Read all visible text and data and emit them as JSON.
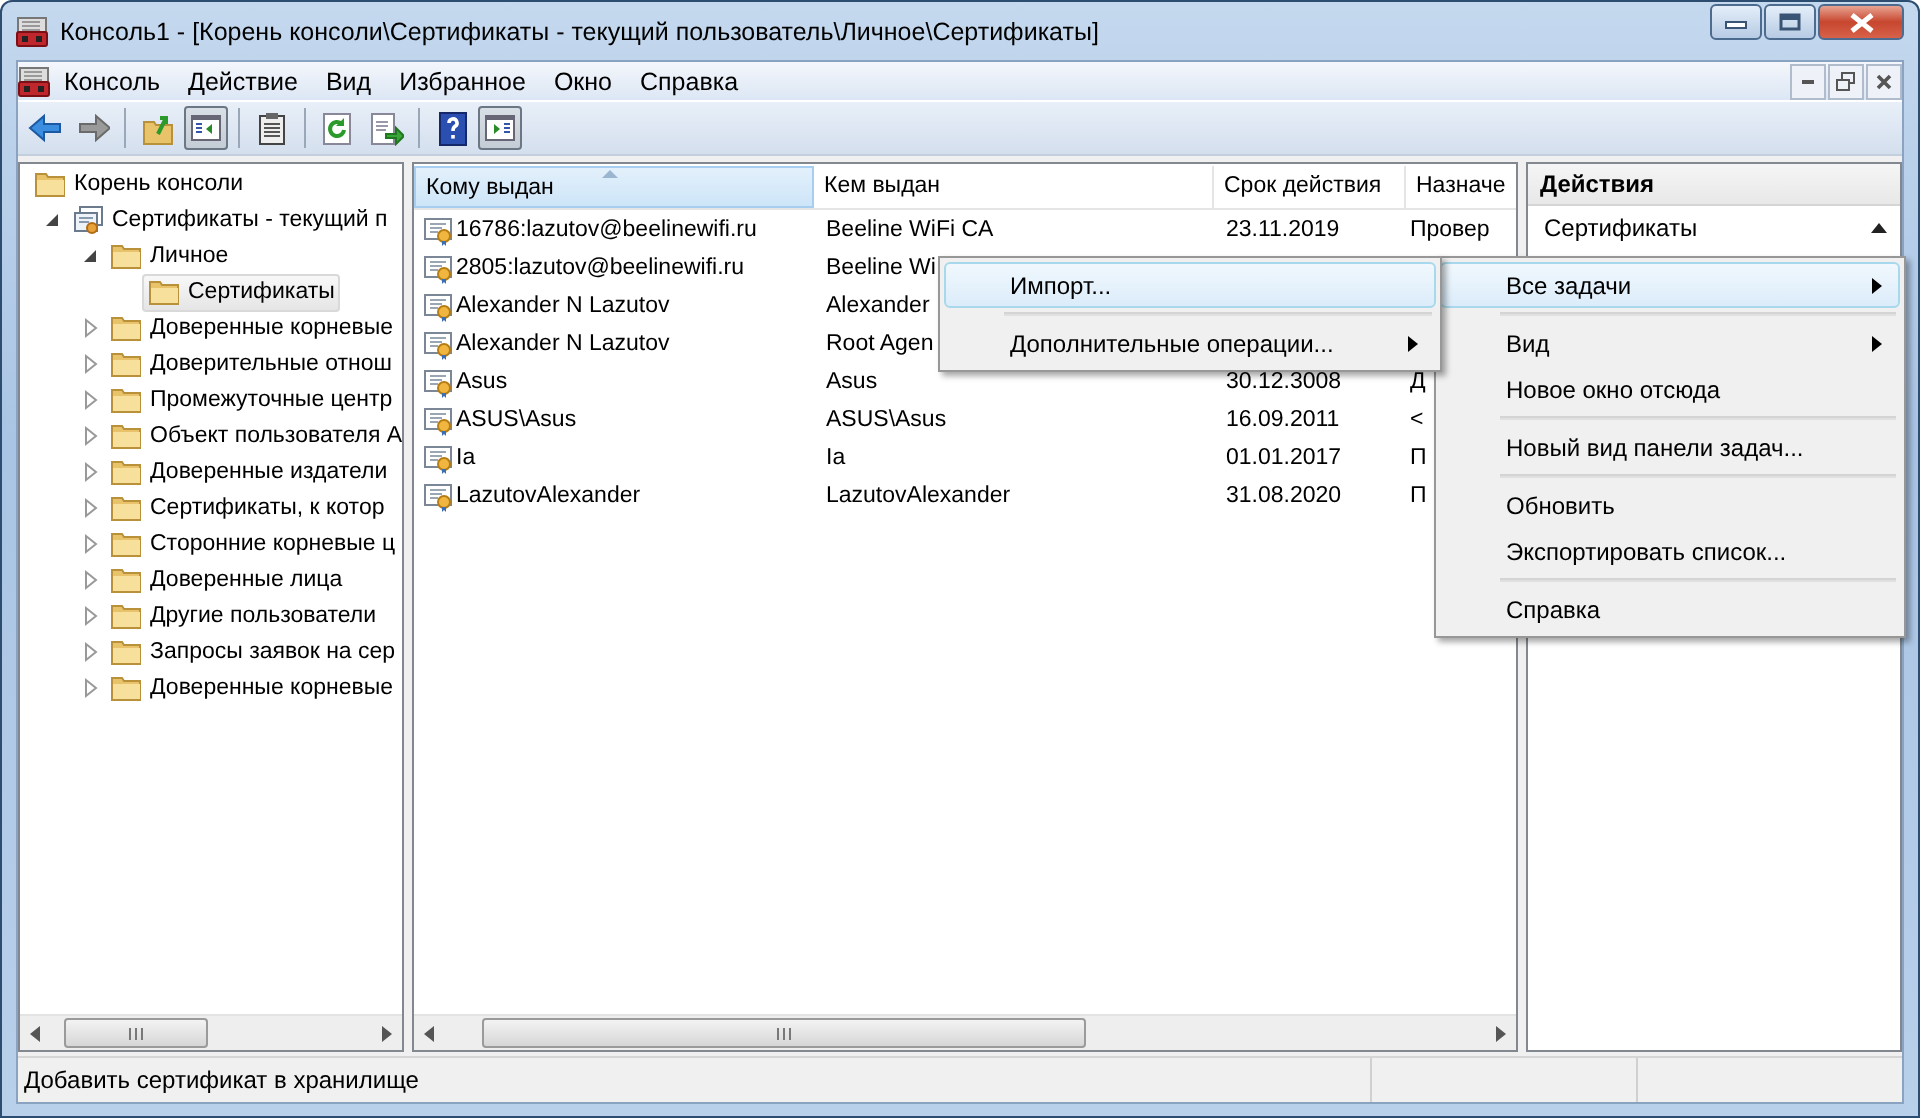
{
  "window": {
    "title": "Консоль1 - [Корень консоли\\Сертификаты - текущий пользователь\\Личное\\Сертификаты]"
  },
  "menu_bar": [
    "Консоль",
    "Действие",
    "Вид",
    "Избранное",
    "Окно",
    "Справка"
  ],
  "toolbar": [
    {
      "kind": "back",
      "pressed": false
    },
    {
      "kind": "forward",
      "pressed": false
    },
    {
      "kind": "separator"
    },
    {
      "kind": "up",
      "pressed": false
    },
    {
      "kind": "tree-toggle",
      "pressed": true
    },
    {
      "kind": "separator"
    },
    {
      "kind": "properties",
      "pressed": false
    },
    {
      "kind": "separator"
    },
    {
      "kind": "refresh",
      "pressed": false
    },
    {
      "kind": "export",
      "pressed": false
    },
    {
      "kind": "separator"
    },
    {
      "kind": "help",
      "pressed": false
    },
    {
      "kind": "actions-toggle",
      "pressed": true
    }
  ],
  "tree": {
    "items": [
      {
        "label": "Корень консоли",
        "kind": "folder",
        "selected": false,
        "children": [
          {
            "label": "Сертификаты - текущий п",
            "kind": "snap-in",
            "expanded": true,
            "selected": false,
            "children": [
              {
                "label": "Личное",
                "kind": "folder",
                "expanded": true,
                "selected": false,
                "children": [
                  {
                    "label": "Сертификаты",
                    "kind": "folder",
                    "selected": true
                  }
                ]
              },
              {
                "label": "Доверенные корневые",
                "kind": "folder",
                "expanded": false,
                "selected": false
              },
              {
                "label": "Доверительные отнош",
                "kind": "folder",
                "expanded": false,
                "selected": false
              },
              {
                "label": "Промежуточные центр",
                "kind": "folder",
                "expanded": false,
                "selected": false
              },
              {
                "label": "Объект пользователя А",
                "kind": "folder",
                "expanded": false,
                "selected": false
              },
              {
                "label": "Доверенные издатели",
                "kind": "folder",
                "expanded": false,
                "selected": false
              },
              {
                "label": "Сертификаты, к котор",
                "kind": "folder",
                "expanded": false,
                "selected": false
              },
              {
                "label": "Сторонние корневые ц",
                "kind": "folder",
                "expanded": false,
                "selected": false
              },
              {
                "label": "Доверенные лица",
                "kind": "folder",
                "expanded": false,
                "selected": false
              },
              {
                "label": "Другие пользователи",
                "kind": "folder",
                "expanded": false,
                "selected": false
              },
              {
                "label": "Запросы заявок на сер",
                "kind": "folder",
                "expanded": false,
                "selected": false
              },
              {
                "label": "Доверенные корневые",
                "kind": "folder",
                "expanded": false,
                "selected": false
              }
            ]
          }
        ]
      }
    ]
  },
  "table": {
    "columns": [
      {
        "label": "Кому выдан",
        "sorted": true
      },
      {
        "label": "Кем выдан",
        "sorted": false
      },
      {
        "label": "Срок действия",
        "sorted": false
      },
      {
        "label": "Назначе",
        "sorted": false
      }
    ],
    "rows": [
      {
        "cells": [
          "16786:lazutov@beelinewifi.ru",
          "Beeline WiFi CA",
          "23.11.2019",
          "Провер"
        ]
      },
      {
        "cells": [
          "2805:lazutov@beelinewifi.ru",
          "Beeline Wi"
        ]
      },
      {
        "cells": [
          "Alexander N Lazutov",
          "Alexander"
        ]
      },
      {
        "cells": [
          "Alexander N Lazutov",
          "Root Agen"
        ]
      },
      {
        "cells": [
          "Asus",
          "Asus",
          "30.12.3008",
          "Д"
        ]
      },
      {
        "cells": [
          "ASUS\\Asus",
          "ASUS\\Asus",
          "16.09.2011",
          "<"
        ]
      },
      {
        "cells": [
          "Ia",
          "Ia",
          "01.01.2017",
          "П"
        ]
      },
      {
        "cells": [
          "LazutovAlexander",
          "LazutovAlexander",
          "31.08.2020",
          "П"
        ]
      }
    ]
  },
  "actions": {
    "title": "Действия",
    "sections": [
      {
        "label": "Сертификаты",
        "expanded": true
      }
    ]
  },
  "context_menu": {
    "items": [
      {
        "kind": "submenu",
        "label": "Все задачи",
        "selected": true
      },
      {
        "kind": "separator"
      },
      {
        "kind": "submenu",
        "label": "Вид",
        "selected": false
      },
      {
        "kind": "item",
        "label": "Новое окно отсюда",
        "selected": false
      },
      {
        "kind": "separator"
      },
      {
        "kind": "item",
        "label": "Новый вид панели задач...",
        "selected": false
      },
      {
        "kind": "separator"
      },
      {
        "kind": "item",
        "label": "Обновить",
        "selected": false
      },
      {
        "kind": "item",
        "label": "Экспортировать список...",
        "selected": false
      },
      {
        "kind": "separator"
      },
      {
        "kind": "item",
        "label": "Справка",
        "selected": false
      }
    ]
  },
  "submenu": {
    "items": [
      {
        "kind": "item",
        "label": "Импорт...",
        "selected": true
      },
      {
        "kind": "separator"
      },
      {
        "kind": "submenu",
        "label": "Дополнительные операции...",
        "selected": false
      }
    ]
  },
  "status_bar": {
    "text": "Добавить сертификат в хранилище"
  }
}
